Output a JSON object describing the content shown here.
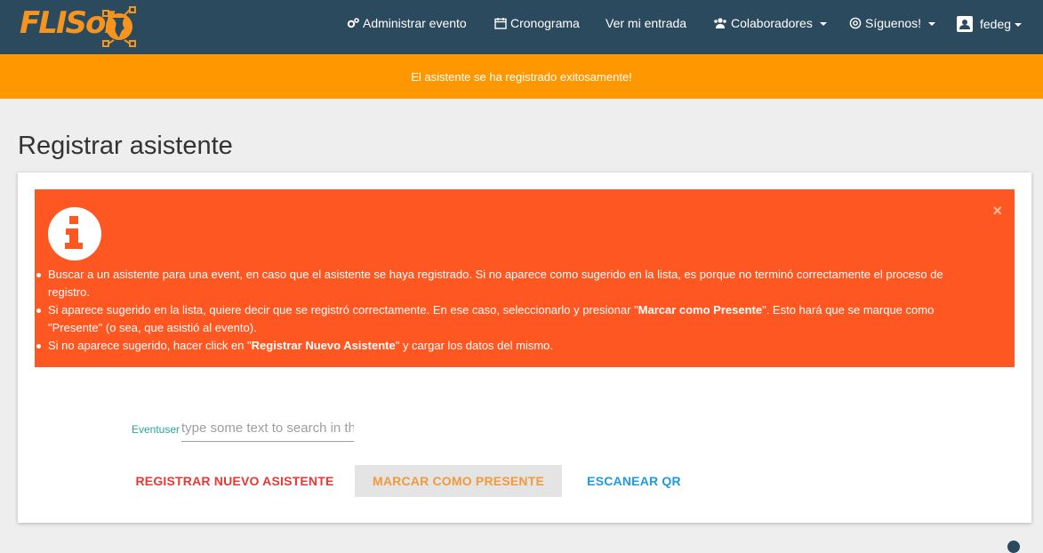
{
  "navbar": {
    "brand": "FLISoL",
    "items": [
      {
        "label": "Administrar evento",
        "icon": "gears-icon"
      },
      {
        "label": "Cronograma",
        "icon": "calendar-icon"
      },
      {
        "label": "Ver mi entrada",
        "icon": ""
      },
      {
        "label": "Colaboradores",
        "icon": "users-icon"
      },
      {
        "label": "Síguenos!",
        "icon": "at-icon"
      }
    ],
    "user": {
      "name": "fedeg",
      "icon": "account-box-icon"
    }
  },
  "banner": {
    "message": "El asistente se ha registrado exitosamente!"
  },
  "page": {
    "title": "Registrar asistente"
  },
  "alert": {
    "close": "×",
    "items": [
      {
        "text": "Buscar a un asistente para una event, en caso que el asistente se haya registrado. Si no aparece como sugerido en la lista, es porque no terminó correctamente el proceso de registro."
      },
      {
        "pre": "Si aparece sugerido en la lista, quiere decir que se registró correctamente. En ese caso, seleccionarlo y presionar \"",
        "bold": "Marcar como Presente",
        "post": "\". Esto hará que se marque como \"Presente\" (o sea, que asistió al evento)."
      },
      {
        "pre": "Si no aparece sugerido, hacer click en \"",
        "bold": "Registrar Nuevo Asistente",
        "post": "\" y cargar los datos del mismo."
      }
    ]
  },
  "search": {
    "label": "Eventuser",
    "placeholder": "type some text to search in the list",
    "value": ""
  },
  "actions": {
    "register": "REGISTRAR NUEVO ASISTENTE",
    "present": "MARCAR COMO PRESENTE",
    "qr": "ESCANEAR QR"
  }
}
